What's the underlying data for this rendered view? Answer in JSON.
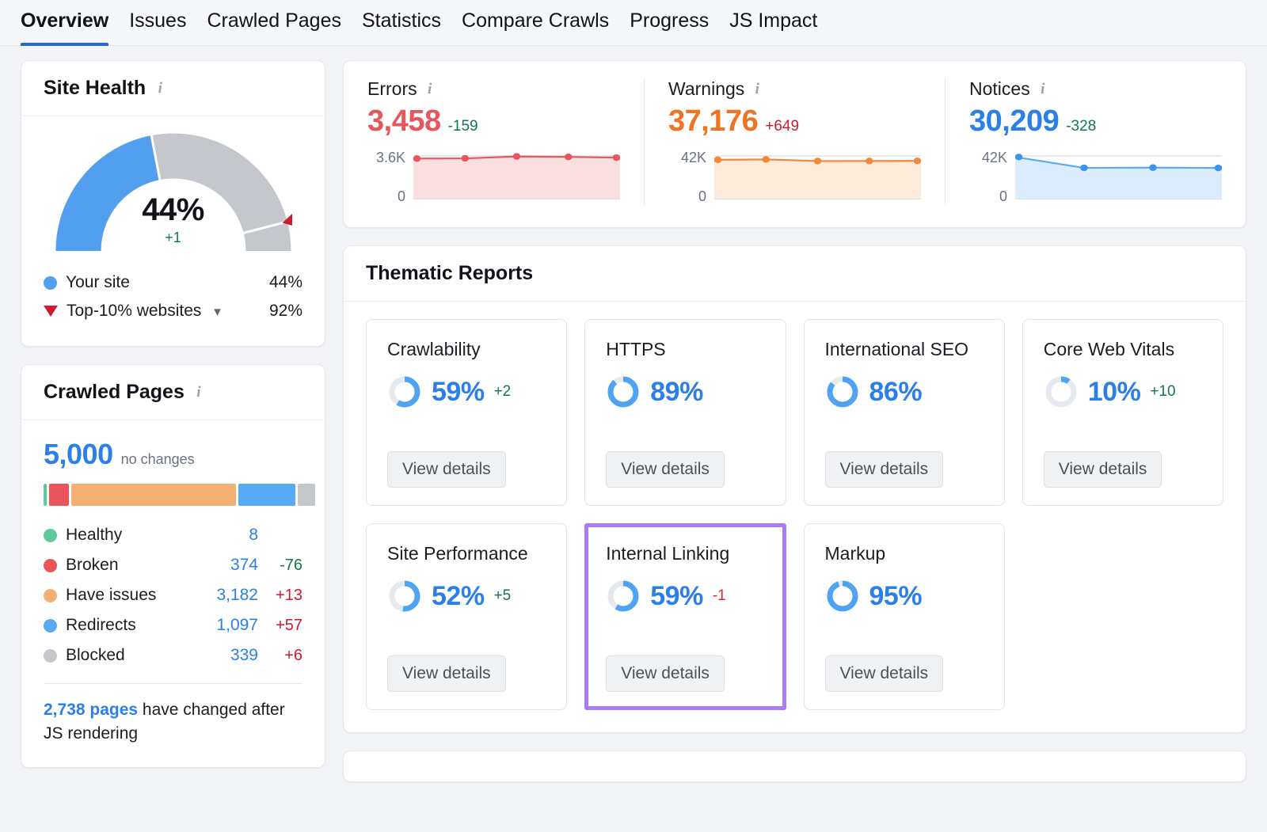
{
  "tabs": [
    {
      "label": "Overview",
      "active": true
    },
    {
      "label": "Issues",
      "active": false
    },
    {
      "label": "Crawled Pages",
      "active": false
    },
    {
      "label": "Statistics",
      "active": false
    },
    {
      "label": "Compare Crawls",
      "active": false
    },
    {
      "label": "Progress",
      "active": false
    },
    {
      "label": "JS Impact",
      "active": false
    }
  ],
  "site_health": {
    "title": "Site Health",
    "percent_label": "44%",
    "delta_label": "+1",
    "legend": [
      {
        "name": "Your site",
        "value": "44%",
        "marker": "dot",
        "color": "#529fef"
      },
      {
        "name": "Top-10% websites",
        "value": "92%",
        "marker": "triangle-down",
        "color": "#cc1b2e"
      }
    ]
  },
  "crawled_pages": {
    "title": "Crawled Pages",
    "total": "5,000",
    "total_note": "no changes",
    "rows": [
      {
        "label": "Healthy",
        "value": "8",
        "change": "",
        "change_dir": "none",
        "color": "#5ec99a"
      },
      {
        "label": "Broken",
        "value": "374",
        "change": "-76",
        "change_dir": "down",
        "color": "#e8565b"
      },
      {
        "label": "Have issues",
        "value": "3,182",
        "change": "+13",
        "change_dir": "up",
        "color": "#f3b072"
      },
      {
        "label": "Redirects",
        "value": "1,097",
        "change": "+57",
        "change_dir": "up",
        "color": "#5aa9f5"
      },
      {
        "label": "Blocked",
        "value": "339",
        "change": "+6",
        "change_dir": "up",
        "color": "#c4c8cd"
      }
    ],
    "js_note_highlight": "2,738 pages",
    "js_note_rest": " have changed after JS rendering"
  },
  "metrics": [
    {
      "name": "Errors",
      "value": "3,458",
      "change": "-159",
      "change_dir": "down",
      "value_color": "#e8565b",
      "axis_top": "3.6K",
      "axis_bottom": "0"
    },
    {
      "name": "Warnings",
      "value": "37,176",
      "change": "+649",
      "change_dir": "up",
      "value_color": "#f07322",
      "axis_top": "42K",
      "axis_bottom": "0"
    },
    {
      "name": "Notices",
      "value": "30,209",
      "change": "-328",
      "change_dir": "down",
      "value_color": "#2a7fe8",
      "axis_top": "42K",
      "axis_bottom": "0"
    }
  ],
  "thematic_reports": {
    "title": "Thematic Reports",
    "view_details_label": "View details",
    "cards": [
      {
        "name": "Crawlability",
        "percent": "59%",
        "value": 59,
        "change": "+2",
        "change_dir": "up",
        "highlighted": false
      },
      {
        "name": "HTTPS",
        "percent": "89%",
        "value": 89,
        "change": "",
        "change_dir": "none",
        "highlighted": false
      },
      {
        "name": "International SEO",
        "percent": "86%",
        "value": 86,
        "change": "",
        "change_dir": "none",
        "highlighted": false
      },
      {
        "name": "Core Web Vitals",
        "percent": "10%",
        "value": 10,
        "change": "+10",
        "change_dir": "up",
        "highlighted": false
      },
      {
        "name": "Site Performance",
        "percent": "52%",
        "value": 52,
        "change": "+5",
        "change_dir": "up",
        "highlighted": false
      },
      {
        "name": "Internal Linking",
        "percent": "59%",
        "value": 59,
        "change": "-1",
        "change_dir": "down-red",
        "highlighted": true
      },
      {
        "name": "Markup",
        "percent": "95%",
        "value": 95,
        "change": "",
        "change_dir": "none",
        "highlighted": false
      }
    ]
  },
  "chart_data": [
    {
      "type": "donut",
      "title": "Site Health",
      "name": "site-health-gauge",
      "value": 44,
      "benchmark": 92,
      "range": [
        0,
        100
      ],
      "colors": {
        "value": "#529fef",
        "track": "#c4c8cd",
        "benchmark_marker": "#cc1b2e"
      },
      "labels": {
        "center": "44%",
        "delta": "+1"
      }
    },
    {
      "type": "bar",
      "title": "Crawled Pages breakdown",
      "name": "crawled-pages-stacked-bar",
      "orientation": "horizontal-stacked",
      "categories": [
        "Healthy",
        "Broken",
        "Have issues",
        "Redirects",
        "Blocked"
      ],
      "values": [
        8,
        374,
        3182,
        1097,
        339
      ],
      "total": 5000,
      "colors": [
        "#5ec99a",
        "#e8565b",
        "#f3b072",
        "#5aa9f5",
        "#c4c8cd"
      ]
    },
    {
      "type": "area",
      "title": "Errors",
      "name": "errors-sparkline",
      "x": [
        1,
        2,
        3,
        4,
        5
      ],
      "values": [
        3380,
        3395,
        3560,
        3520,
        3458
      ],
      "ylim": [
        0,
        3600
      ],
      "ytick_labels": [
        "0",
        "3.6K"
      ],
      "grid": false,
      "legend": "none",
      "colors": {
        "line": "#e8565b",
        "fill": "#fadfe0",
        "marker": "#e8565b"
      }
    },
    {
      "type": "area",
      "title": "Warnings",
      "name": "warnings-sparkline",
      "x": [
        1,
        2,
        3,
        4,
        5
      ],
      "values": [
        38200,
        38600,
        37000,
        37050,
        37176
      ],
      "ylim": [
        0,
        42000
      ],
      "ytick_labels": [
        "0",
        "42K"
      ],
      "grid": false,
      "legend": "none",
      "colors": {
        "line": "#ef8a3c",
        "fill": "#fceadb",
        "marker": "#ef8a3c"
      }
    },
    {
      "type": "area",
      "title": "Notices",
      "name": "notices-sparkline",
      "x": [
        1,
        2,
        3,
        4
      ],
      "values": [
        41000,
        30300,
        30550,
        30209
      ],
      "ylim": [
        0,
        42000
      ],
      "ytick_labels": [
        "0",
        "42K"
      ],
      "grid": false,
      "legend": "none",
      "colors": {
        "line": "#5aa9f5",
        "fill": "#dbecfd",
        "marker": "#3d93ef"
      }
    },
    {
      "type": "pie",
      "title": "Thematic report scores",
      "name": "thematic-mini-donuts",
      "categories": [
        "Crawlability",
        "HTTPS",
        "International SEO",
        "Core Web Vitals",
        "Site Performance",
        "Internal Linking",
        "Markup"
      ],
      "values": [
        59,
        89,
        86,
        10,
        52,
        59,
        95
      ],
      "units": "percent",
      "colors": {
        "value": "#4ea3f2",
        "track": "#e6e9ee"
      }
    }
  ]
}
